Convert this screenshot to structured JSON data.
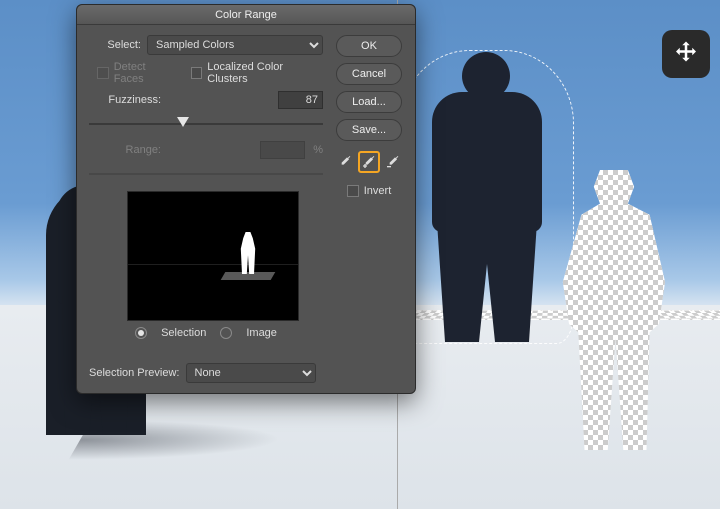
{
  "dialog": {
    "title": "Color Range",
    "select_label": "Select:",
    "select_value": "Sampled Colors",
    "detect_faces": "Detect Faces",
    "localized": "Localized Color Clusters",
    "fuzziness_label": "Fuzziness:",
    "fuzziness_value": "87",
    "range_label": "Range:",
    "range_unit": "%",
    "radio_selection": "Selection",
    "radio_image": "Image",
    "invert": "Invert",
    "preview_label": "Selection Preview:",
    "preview_value": "None",
    "buttons": {
      "ok": "OK",
      "cancel": "Cancel",
      "load": "Load...",
      "save": "Save..."
    },
    "eyedroppers": [
      "eyedropper",
      "eyedropper-add",
      "eyedropper-subtract"
    ],
    "highlighted_eyedropper": 1
  },
  "tool_icon": "move-tool"
}
